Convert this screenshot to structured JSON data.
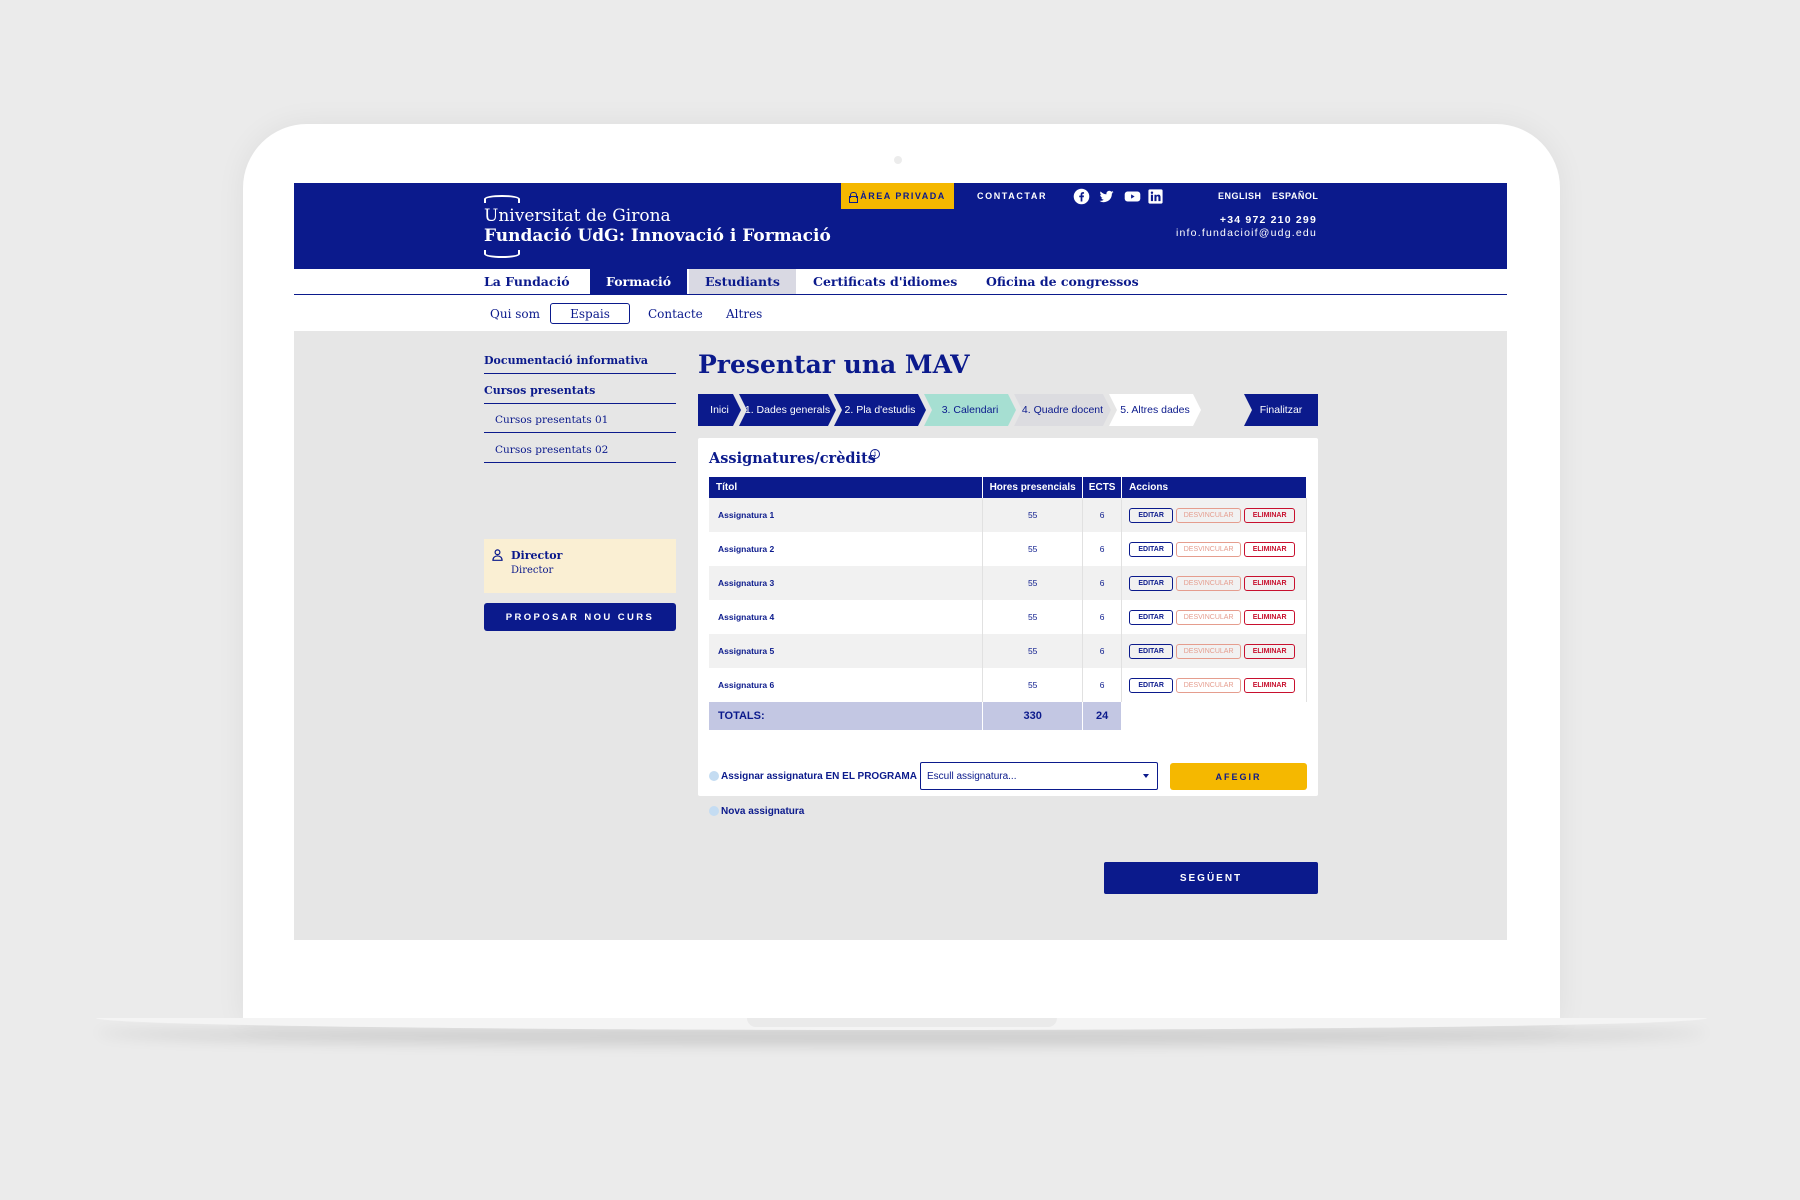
{
  "header": {
    "logo_line1": "Universitat de Girona",
    "logo_line2": "Fundació UdG: Innovació i Formació",
    "private_area": "ÀREA PRIVADA",
    "contact": "CONTACTAR",
    "social_icons": [
      "facebook-icon",
      "twitter-icon",
      "youtube-icon",
      "linkedin-icon"
    ],
    "languages": [
      "ENGLISH",
      "ESPAÑOL"
    ],
    "phone": "+34 972 210 299",
    "email": "info.fundacioif@udg.edu"
  },
  "main_nav": [
    {
      "label": "La Fundació",
      "state": "normal"
    },
    {
      "label": "Formació",
      "state": "active"
    },
    {
      "label": "Estudiants",
      "state": "hover"
    },
    {
      "label": "Certificats d'idiomes",
      "state": "normal"
    },
    {
      "label": "Oficina de congressos",
      "state": "normal"
    }
  ],
  "sub_nav": [
    {
      "label": "Qui som"
    },
    {
      "label": "Espais",
      "active": true
    },
    {
      "label": "Contacte"
    },
    {
      "label": "Altres"
    }
  ],
  "sidebar": {
    "links": [
      {
        "label": "Documentació informativa",
        "level": "main"
      },
      {
        "label": "Cursos presentats",
        "level": "main"
      },
      {
        "label": "Cursos presentats 01",
        "level": "sub"
      },
      {
        "label": "Cursos presentats 02",
        "level": "sub"
      }
    ],
    "director": {
      "name": "Director",
      "role": "Director"
    },
    "propose_button": "PROPOSAR NOU CURS"
  },
  "page_title": "Presentar una MAV",
  "steps": [
    {
      "label": "Inici",
      "state": "done"
    },
    {
      "label": "1. Dades generals",
      "state": "done"
    },
    {
      "label": "2. Pla d'estudis",
      "state": "done"
    },
    {
      "label": "3. Calendari",
      "state": "current"
    },
    {
      "label": "4. Quadre docent",
      "state": "pending"
    },
    {
      "label": "5. Altres dades",
      "state": "pending"
    },
    {
      "label": "Finalitzar",
      "state": "done"
    }
  ],
  "card": {
    "title": "Assignatures/crèdits",
    "info": "i",
    "columns": [
      "Títol",
      "Hores presencials",
      "ECTS",
      "Accions"
    ],
    "rows": [
      {
        "title": "Assignatura 1",
        "hours": "55",
        "ects": "6"
      },
      {
        "title": "Assignatura 2",
        "hours": "55",
        "ects": "6"
      },
      {
        "title": "Assignatura 3",
        "hours": "55",
        "ects": "6"
      },
      {
        "title": "Assignatura 4",
        "hours": "55",
        "ects": "6"
      },
      {
        "title": "Assignatura 5",
        "hours": "55",
        "ects": "6"
      },
      {
        "title": "Assignatura 6",
        "hours": "55",
        "ects": "6"
      }
    ],
    "actions": {
      "edit": "EDITAR",
      "unlink": "DESVINCULAR",
      "delete": "ELIMINAR"
    },
    "totals": {
      "label": "TOTALS:",
      "hours": "330",
      "ects": "24"
    },
    "assign_label": "Assignar assignatura EN EL PROGRAMA",
    "select_placeholder": "Escull assignatura...",
    "add_button": "AFEGIR",
    "new_label": "Nova assignatura"
  },
  "next_button": "SEGÜENT",
  "colors": {
    "brand": "#0b1a8c",
    "accent": "#f5b800",
    "current_step": "#a6dfd2",
    "danger": "#c8102e"
  }
}
